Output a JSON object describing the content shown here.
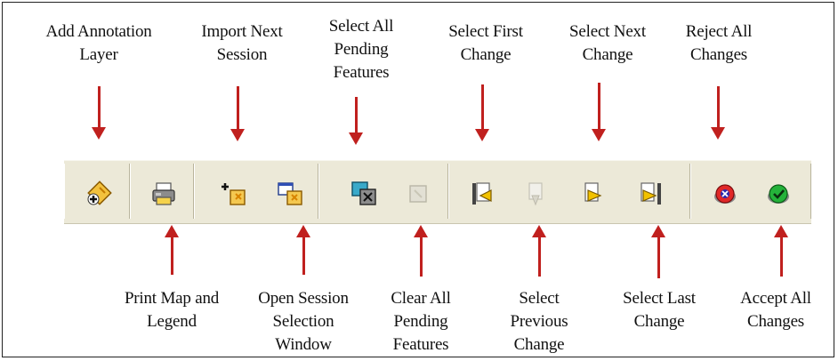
{
  "labels_top": {
    "add_annotation_layer": "Add Annotation\nLayer",
    "import_next_session": "Import Next\nSession",
    "select_all_pending": "Select All\nPending\nFeatures",
    "select_first_change": "Select First\nChange",
    "select_next_change": "Select Next\nChange",
    "reject_all_changes": "Reject All\nChanges"
  },
  "labels_bottom": {
    "print_map_legend": "Print Map and\nLegend",
    "open_session_selection": "Open Session\nSelection\nWindow",
    "clear_all_pending": "Clear All\nPending\nFeatures",
    "select_previous_change": "Select\nPrevious\nChange",
    "select_last_change": "Select Last\nChange",
    "accept_all_changes": "Accept All\nChanges"
  },
  "colors": {
    "arrow": "#c0201e",
    "toolbar_bg": "#ece9d8"
  },
  "icons": [
    "add-annotation-layer-icon",
    "print-map-icon",
    "import-next-session-icon",
    "open-session-window-icon",
    "select-all-pending-icon",
    "clear-all-pending-icon",
    "select-first-change-icon",
    "select-previous-change-icon",
    "select-next-change-icon",
    "select-last-change-icon",
    "reject-all-changes-icon",
    "accept-all-changes-icon"
  ]
}
